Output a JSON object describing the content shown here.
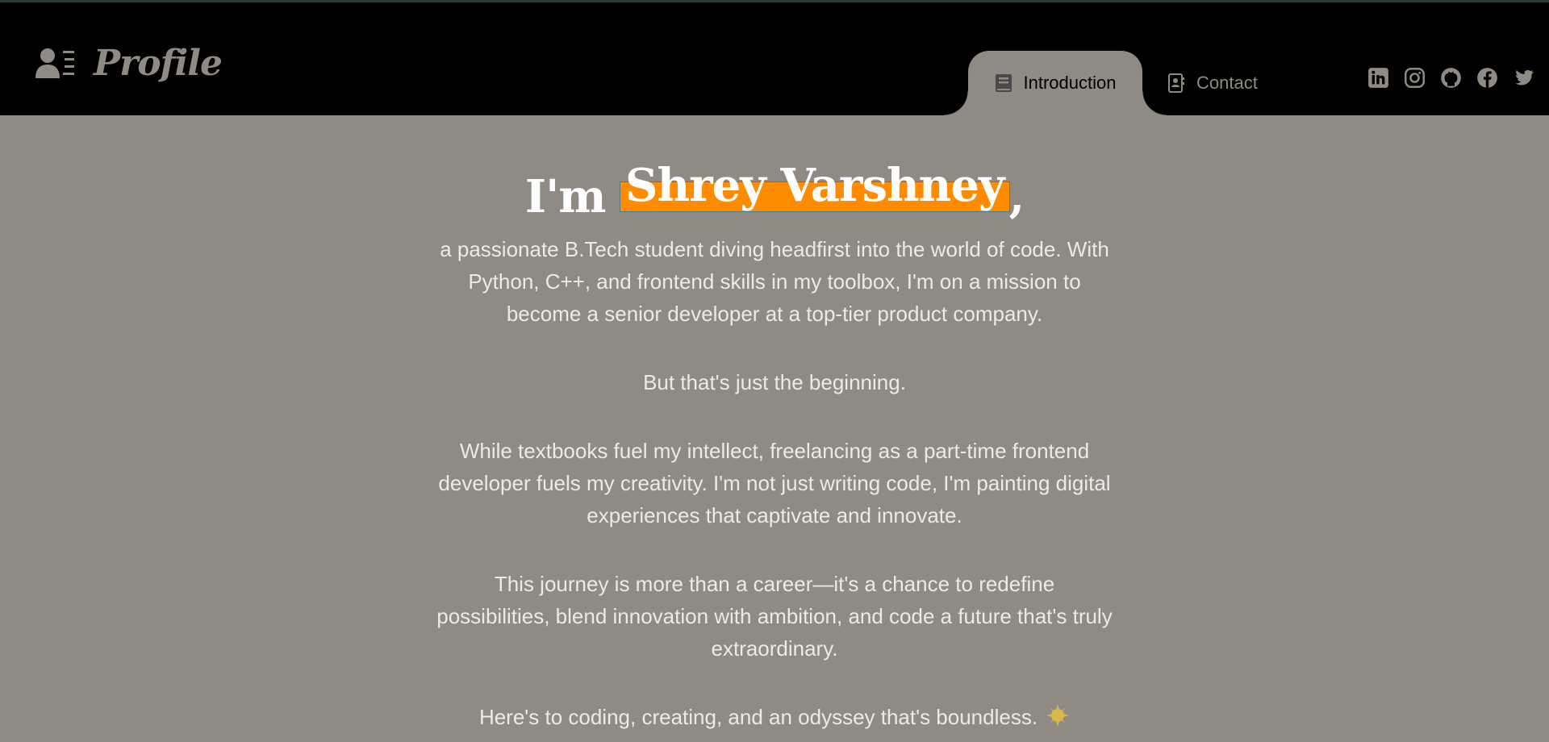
{
  "brand": {
    "title": "Profile",
    "icon": "user-list-icon"
  },
  "nav": {
    "tabs": [
      {
        "label": "Introduction",
        "icon": "book-icon",
        "active": true
      },
      {
        "label": "Contact",
        "icon": "address-book-icon",
        "active": false
      }
    ],
    "socials": [
      "linkedin-icon",
      "instagram-icon",
      "github-icon",
      "facebook-icon",
      "twitter-icon"
    ]
  },
  "hero": {
    "prefix": "I'm",
    "name": "Shrey Varshney",
    "suffix": ","
  },
  "paragraphs": [
    "a passionate B.Tech student diving headfirst into the world of code. With Python, C++, and frontend skills in my toolbox, I'm on a mission to become a senior developer at a top-tier product company.",
    "But that's just the beginning.",
    "While textbooks fuel my intellect, freelancing as a part-time frontend developer fuels my creativity. I'm not just writing code, I'm painting digital experiences that captivate and innovate.",
    "This journey is more than a career—it's a chance to redefine possibilities, blend innovation with ambition, and code a future that's truly extraordinary.",
    "Here's to coding, creating, and an odyssey that's boundless."
  ],
  "colors": {
    "background": "#8f8b84",
    "header": "#000000",
    "highlight": "#ff8c00"
  }
}
